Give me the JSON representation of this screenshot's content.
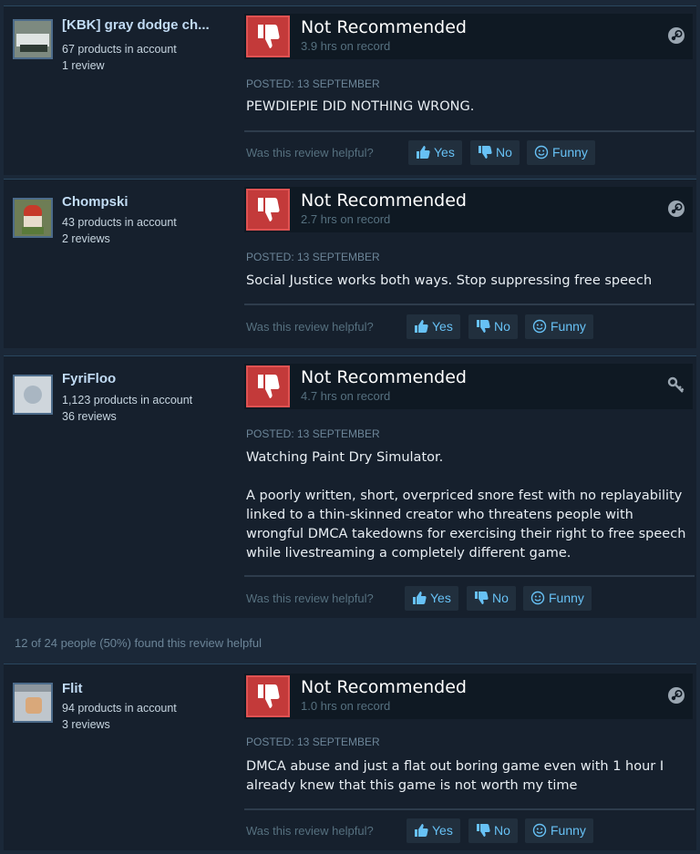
{
  "labels": {
    "helpful_question": "Was this review helpful?",
    "yes": "Yes",
    "no": "No",
    "funny": "Funny"
  },
  "reviews": [
    {
      "author": "[KBK] gray dodge ch...",
      "products": "67 products in account",
      "reviews_count": "1 review",
      "verdict": "Not Recommended",
      "hours": "3.9 hrs on record",
      "posted": "POSTED: 13 SEPTEMBER",
      "paragraphs": [
        "PEWDIEPIE DID NOTHING WRONG."
      ],
      "platform_icon": "steam-icon"
    },
    {
      "author": "Chompski",
      "products": "43 products in account",
      "reviews_count": "2 reviews",
      "verdict": "Not Recommended",
      "hours": "2.7 hrs on record",
      "posted": "POSTED: 13 SEPTEMBER",
      "paragraphs": [
        "Social Justice works both ways. Stop suppressing free speech"
      ],
      "platform_icon": "steam-icon"
    },
    {
      "author": "FyriFloo",
      "products": "1,123 products in account",
      "reviews_count": "36 reviews",
      "verdict": "Not Recommended",
      "hours": "4.7 hrs on record",
      "posted": "POSTED: 13 SEPTEMBER",
      "paragraphs": [
        "Watching Paint Dry Simulator.",
        "A poorly written, short, overpriced snore fest with no replayability linked to a thin-skinned creator who threatens people with wrongful DMCA takedowns for exercising their right to free speech while livestreaming a completely different game."
      ],
      "platform_icon": "key-icon"
    },
    {
      "author": "Flit",
      "products": "94 products in account",
      "reviews_count": "3 reviews",
      "verdict": "Not Recommended",
      "hours": "1.0 hrs on record",
      "posted": "POSTED: 13 SEPTEMBER",
      "paragraphs": [
        "DMCA abuse and just a flat out boring game even with 1 hour I already knew that this game is not worth my time"
      ],
      "platform_icon": "steam-icon"
    }
  ],
  "found_helpful": "12 of 24 people (50%) found this review helpful"
}
